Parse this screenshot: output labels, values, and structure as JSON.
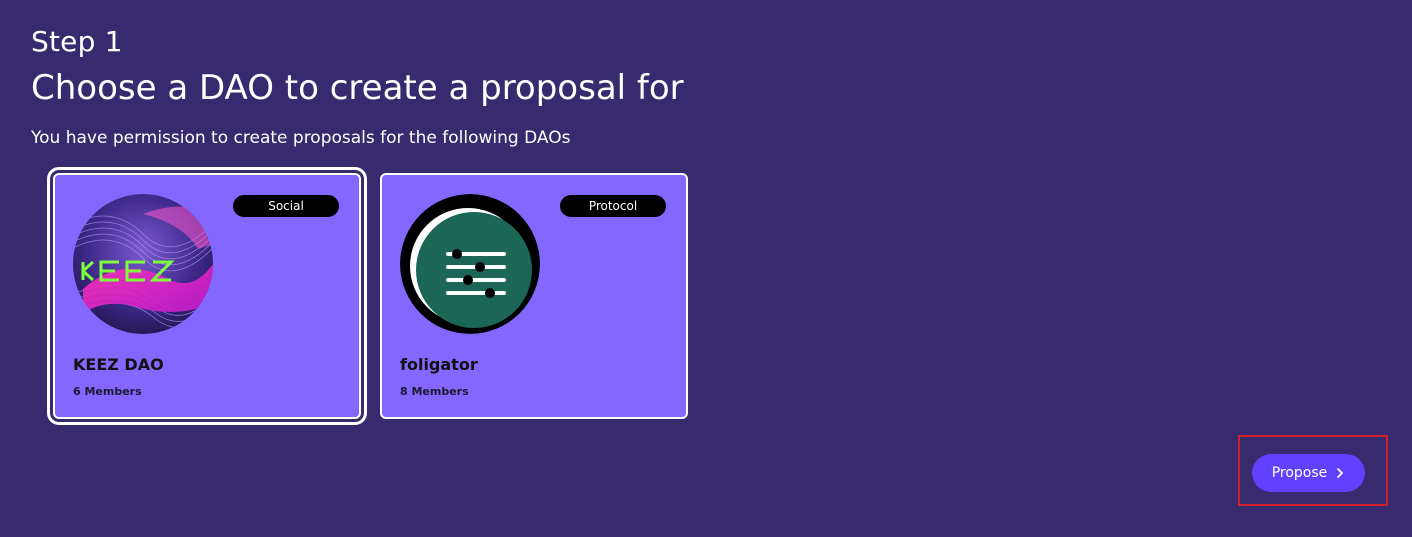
{
  "header": {
    "step": "Step 1",
    "title": "Choose a DAO to create a proposal for",
    "subtitle": "You have permission to create proposals for the following DAOs"
  },
  "daos": [
    {
      "name": "KEEZ DAO",
      "members": "6 Members",
      "category": "Social",
      "selected": true,
      "logo_text": "KEEZ",
      "icon": "keez-logo-icon"
    },
    {
      "name": "foligator",
      "members": "8 Members",
      "category": "Protocol",
      "selected": false,
      "icon": "foligator-logo-icon"
    }
  ],
  "actions": {
    "propose_label": "Propose",
    "propose_icon": "chevron-right-icon"
  },
  "colors": {
    "background": "#382a6e",
    "card": "#8367ff",
    "button": "#6140ff",
    "badge": "#000000",
    "highlight": "#d01e2a"
  }
}
